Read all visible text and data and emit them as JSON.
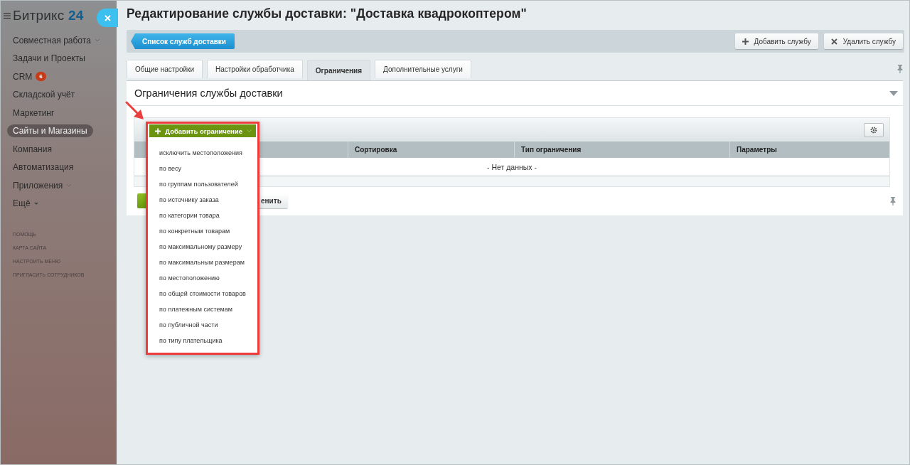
{
  "sidebar": {
    "logo": {
      "name": "Битрикс",
      "number": "24"
    },
    "items": [
      {
        "label": "Совместная работа",
        "selected": false,
        "kind": "group"
      },
      {
        "label": "Задачи и Проекты",
        "selected": false,
        "kind": "link"
      },
      {
        "label": "CRM",
        "selected": false,
        "kind": "link",
        "badge": "6"
      },
      {
        "label": "Складской учёт",
        "selected": false,
        "kind": "link"
      },
      {
        "label": "Маркетинг",
        "selected": false,
        "kind": "link"
      },
      {
        "label": "Сайты и Магазины",
        "selected": true,
        "kind": "link"
      },
      {
        "label": "Компания",
        "selected": false,
        "kind": "link"
      },
      {
        "label": "Автоматизация",
        "selected": false,
        "kind": "link"
      },
      {
        "label": "Приложения",
        "selected": false,
        "kind": "group"
      },
      {
        "label": "Ещё",
        "selected": false,
        "kind": "more"
      }
    ],
    "footer_links": [
      "ПОМОЩЬ",
      "КАРТА САЙТА",
      "НАСТРОИТЬ МЕНЮ",
      "ПРИГЛАСИТЬ СОТРУДНИКОВ"
    ]
  },
  "page": {
    "title": "Редактирование службы доставки: \"Доставка квадрокоптером\"",
    "toolbar": {
      "back_button": "Список служб доставки",
      "buttons": [
        {
          "label": "Добавить службу",
          "kind": "add"
        },
        {
          "label": "Удалить службу",
          "kind": "delete"
        }
      ]
    },
    "tabs": [
      {
        "label": "Общие настройки",
        "selected": false
      },
      {
        "label": "Настройки обработчика",
        "selected": false
      },
      {
        "label": "Ограничения",
        "selected": true
      },
      {
        "label": "Дополнительные услуги",
        "selected": false
      }
    ],
    "section": {
      "title": "Ограничения службы доставки",
      "add_button": "Добавить ограничение",
      "menu": [
        "исключить местоположения",
        "по весу",
        "по группам пользователей",
        "по источнику заказа",
        "по категории товара",
        "по конкретным товарам",
        "по максимальному размеру",
        "по максимальным размерам",
        "по местоположению",
        "по общей стоимости товаров",
        "по платежным системам",
        "по публичной части",
        "по типу плательщика"
      ],
      "table": {
        "columns": [
          "Сортировка",
          "Тип ограничения",
          "Параметры"
        ],
        "empty_text": "- Нет данных -"
      },
      "apply_button": "енить"
    }
  }
}
